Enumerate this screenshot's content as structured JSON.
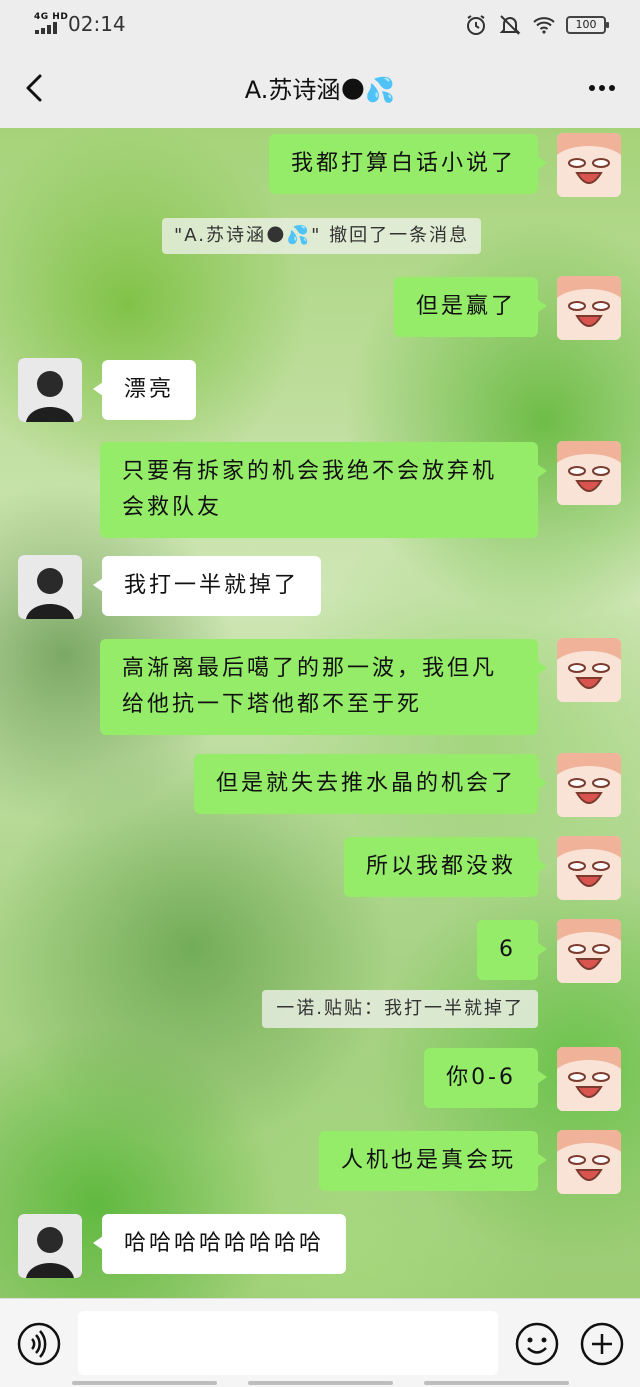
{
  "status_bar": {
    "network": "4G HD",
    "time": "02:14",
    "battery": "100"
  },
  "header": {
    "title": "A.苏诗涵🌑💦",
    "back_icon": "back-chevron-icon",
    "more_icon": "more-dots-icon"
  },
  "messages": [
    {
      "type": "out",
      "text": "我都打算白话小说了"
    },
    {
      "type": "system",
      "text": "\"A.苏诗涵🌑💦\" 撤回了一条消息"
    },
    {
      "type": "out",
      "text": "但是赢了"
    },
    {
      "type": "in",
      "text": "漂亮"
    },
    {
      "type": "out",
      "text": "只要有拆家的机会我绝不会放弃机会救队友"
    },
    {
      "type": "in",
      "text": "我打一半就掉了"
    },
    {
      "type": "out",
      "text": "高渐离最后噶了的那一波，我但凡给他抗一下塔他都不至于死"
    },
    {
      "type": "out",
      "text": "但是就失去推水晶的机会了"
    },
    {
      "type": "out",
      "text": "所以我都没救"
    },
    {
      "type": "out",
      "text": "6"
    },
    {
      "type": "quote",
      "text": "一诺.贴贴：我打一半就掉了"
    },
    {
      "type": "out",
      "text": "你0-6"
    },
    {
      "type": "out",
      "text": "人机也是真会玩"
    },
    {
      "type": "in",
      "text": "哈哈哈哈哈哈哈哈"
    }
  ],
  "input": {
    "placeholder": "",
    "voice_icon": "voice-icon",
    "emoji_icon": "emoji-icon",
    "plus_icon": "plus-icon"
  },
  "colors": {
    "outgoing_bubble": "#95ec69",
    "incoming_bubble": "#ffffff",
    "bar_background": "#ededed"
  }
}
